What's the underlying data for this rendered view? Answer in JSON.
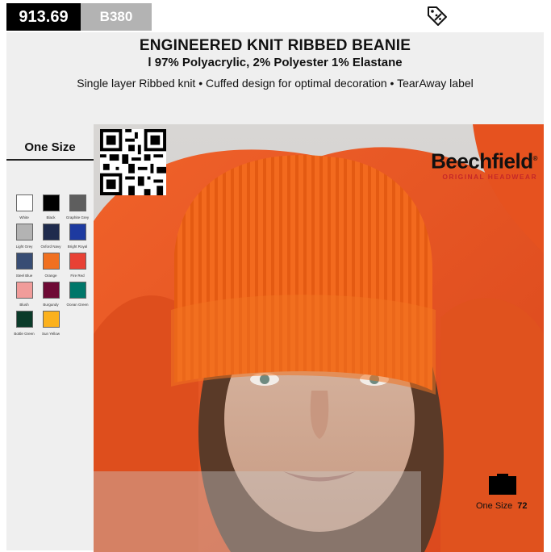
{
  "product": {
    "code": "913.69",
    "ref": "B380",
    "title": "ENGINEERED KNIT RIBBED BEANIE",
    "composition": "l 97% Polyacrylic, 2% Polyester 1% Elastane",
    "features": "Single layer Ribbed knit • Cuffed design for optimal decoration • TearAway label"
  },
  "icons": {
    "tag": "discount-tag-icon",
    "qr": "qr-code-icon",
    "box": "carton-box-icon"
  },
  "sizes": {
    "label": "One Size"
  },
  "colors": [
    {
      "name": "White",
      "hex": "#ffffff"
    },
    {
      "name": "Black",
      "hex": "#000000"
    },
    {
      "name": "Graphite Grey",
      "hex": "#5e5e5e"
    },
    {
      "name": "Light Grey",
      "hex": "#b3b3b3"
    },
    {
      "name": "Oxford Navy",
      "hex": "#1f2b4d"
    },
    {
      "name": "Bright Royal",
      "hex": "#1d3aa0"
    },
    {
      "name": "Steel Blue",
      "hex": "#384d74"
    },
    {
      "name": "Orange",
      "hex": "#f07020"
    },
    {
      "name": "Fire Red",
      "hex": "#e84135"
    },
    {
      "name": "Blush",
      "hex": "#f19c9a"
    },
    {
      "name": "Burgundy",
      "hex": "#6e0a35"
    },
    {
      "name": "Ocean Green",
      "hex": "#00776a"
    },
    {
      "name": "Bottle Green",
      "hex": "#0b3b2a"
    },
    {
      "name": "Sun Yellow",
      "hex": "#fbb11d"
    }
  ],
  "brand": {
    "name": "Beechfield",
    "reg": "®",
    "tagline": "ORIGINAL HEADWEAR"
  },
  "packing": {
    "size_label": "One Size",
    "quantity": "72"
  },
  "theme": {
    "accent_black": "#000000",
    "ref_grey": "#b3b3b3",
    "panel_grey": "#efefef",
    "beanie_orange": "#f06a1c",
    "brand_red": "#c62828"
  }
}
